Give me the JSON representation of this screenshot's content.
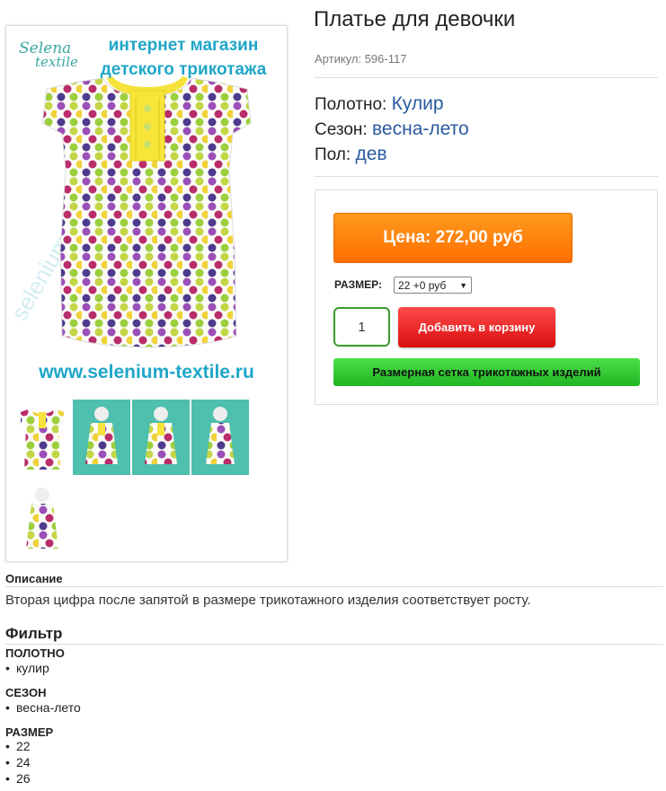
{
  "gallery": {
    "brand_line1": "Selena",
    "brand_line2": "textile",
    "shop_title_line1": "интернет магазин",
    "shop_title_line2": "детского трикотажа",
    "website": "www.selenium-textile.ru"
  },
  "product": {
    "title": "Платье для девочки",
    "sku": "Артикул: 596-117",
    "attributes": [
      {
        "label": "Полотно:",
        "value": "Кулир"
      },
      {
        "label": "Сезон:",
        "value": "весна-лето"
      },
      {
        "label": "Пол:",
        "value": "дев"
      }
    ]
  },
  "buybox": {
    "price_label": "Цена: 272,00 руб",
    "size_label": "РАЗМЕР:",
    "size_selected": "22 +0 руб",
    "quantity": "1",
    "add_to_cart": "Добавить в корзину",
    "size_chart": "Размерная сетка трикотажных изделий"
  },
  "description": {
    "heading": "Описание",
    "text": "Вторая цифра после запятой в размере трикотажного изделия соответствует росту."
  },
  "filter": {
    "heading": "Фильтр",
    "groups": [
      {
        "title": "ПОЛОТНО",
        "items": [
          "кулир"
        ]
      },
      {
        "title": "СЕЗОН",
        "items": [
          "весна-лето"
        ]
      },
      {
        "title": "РАЗМЕР",
        "items": [
          "22",
          "24",
          "26"
        ]
      }
    ]
  },
  "colors": {
    "accent_blue": "#2a5aa0",
    "price_orange": "#ff7a00",
    "cart_red": "#e02020",
    "chart_green": "#2fc02f",
    "dress_yellow": "#f5e23a"
  }
}
